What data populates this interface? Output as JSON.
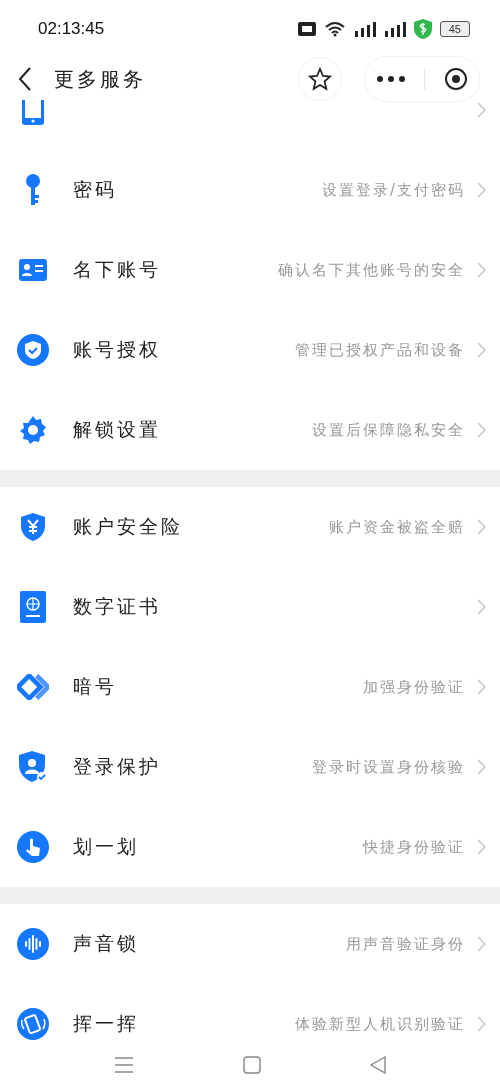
{
  "status_bar": {
    "time": "02:13:45",
    "battery": "45"
  },
  "header": {
    "title": "更多服务"
  },
  "groups": [
    {
      "items": [
        {
          "kind": "cut"
        },
        {
          "kind": "full",
          "title": "密码",
          "subtitle": "设置登录/支付密码"
        },
        {
          "kind": "full",
          "title": "名下账号",
          "subtitle": "确认名下其他账号的安全"
        },
        {
          "kind": "full",
          "title": "账号授权",
          "subtitle": "管理已授权产品和设备"
        },
        {
          "kind": "full",
          "title": "解锁设置",
          "subtitle": "设置后保障隐私安全"
        }
      ]
    },
    {
      "items": [
        {
          "kind": "full",
          "title": "账户安全险",
          "subtitle": "账户资金被盗全赔"
        },
        {
          "kind": "full",
          "title": "数字证书"
        },
        {
          "kind": "full",
          "title": "暗号",
          "subtitle": "加强身份验证"
        },
        {
          "kind": "full",
          "title": "登录保护",
          "subtitle": "登录时设置身份核验"
        },
        {
          "kind": "full",
          "title": "划一划",
          "subtitle": "快捷身份验证"
        }
      ]
    },
    {
      "items": [
        {
          "kind": "full",
          "title": "声音锁",
          "subtitle": "用声音验证身份"
        },
        {
          "kind": "full",
          "title": "挥一挥",
          "subtitle": "体验新型人机识别验证"
        }
      ]
    }
  ]
}
